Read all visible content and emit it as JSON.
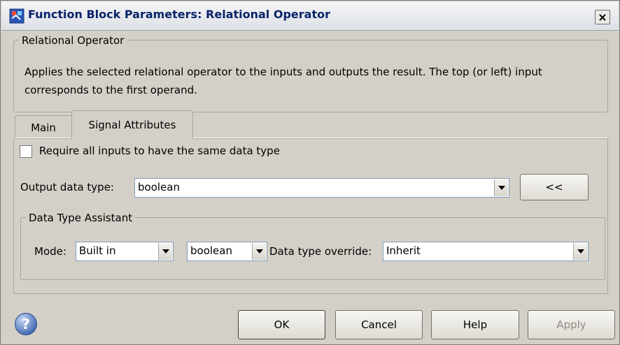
{
  "window": {
    "title": "Function Block Parameters: Relational Operator",
    "close_glyph": "✕"
  },
  "description": {
    "legend": "Relational Operator",
    "text": "Applies the selected relational operator to the inputs and outputs the result. The top (or left) input corresponds to the first operand."
  },
  "tabs": [
    {
      "label": "Main",
      "active": false
    },
    {
      "label": "Signal Attributes",
      "active": true
    }
  ],
  "signal_attributes": {
    "require_same_type_label": "Require all inputs to have the same data type",
    "require_same_type_checked": false,
    "output_data_type_label": "Output data type:",
    "output_data_type_value": "boolean",
    "collapse_button_label": "<<",
    "assistant": {
      "legend": "Data Type Assistant",
      "mode_label": "Mode:",
      "mode_value": "Built in",
      "type_value": "boolean",
      "override_label": "Data type override:",
      "override_value": "Inherit"
    }
  },
  "buttons": {
    "ok": "OK",
    "cancel": "Cancel",
    "help": "Help",
    "apply": "Apply"
  },
  "help_icon_glyph": "?",
  "icons": {
    "app": "simulink-block-icon",
    "close": "close-icon",
    "dropdown": "chevron-down-icon",
    "help": "help-icon"
  }
}
